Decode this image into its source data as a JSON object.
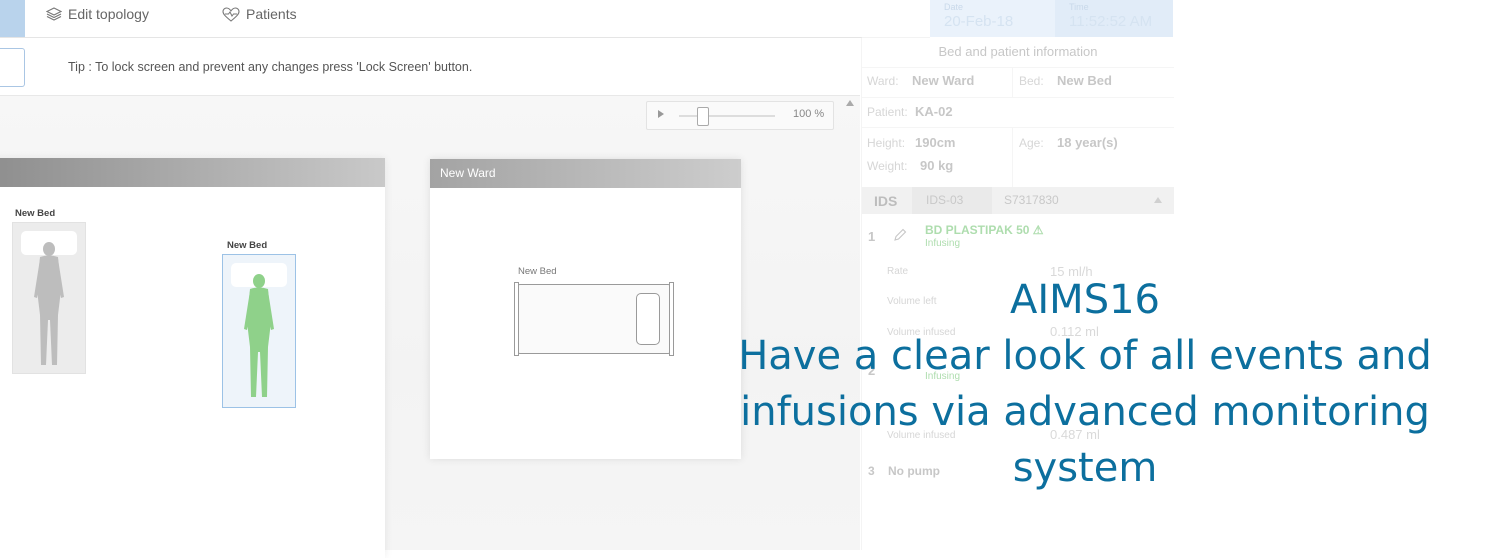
{
  "nav": {
    "edit_topology": "Edit topology",
    "patients": "Patients"
  },
  "datetime": {
    "date_label": "Date",
    "date_value": "20-Feb-18",
    "time_label": "Time",
    "time_value": "11:52:52 AM"
  },
  "tip": "Tip : To lock screen and prevent any changes press 'Lock Screen' button.",
  "zoom": {
    "value": "100 %",
    "level_percent": 100
  },
  "wards": [
    {
      "name": "",
      "beds": [
        {
          "label": "New Bed",
          "status": "empty"
        },
        {
          "label": "New Bed",
          "status": "occupied"
        }
      ]
    },
    {
      "name": "New Ward",
      "beds": [
        {
          "label": "New Bed"
        }
      ]
    }
  ],
  "panel": {
    "title": "Bed and patient information",
    "ward_label": "Ward:",
    "ward_value": "New Ward",
    "bed_label": "Bed:",
    "bed_value": "New Bed",
    "patient_label": "Patient:",
    "patient_value": "KA-02",
    "height_label": "Height:",
    "height_value": "190cm",
    "weight_label": "Weight:",
    "weight_value": "90 kg",
    "age_label": "Age:",
    "age_value": "18 year(s)",
    "ids": {
      "title": "IDS",
      "device": "IDS-03",
      "serial": "S7317830"
    },
    "pumps": [
      {
        "index": "1",
        "drug": "BD PLASTIPAK 50 ⚠",
        "status": "Infusing",
        "rows": [
          {
            "label": "Rate",
            "value": "15 ml/h"
          },
          {
            "label": "Volume left",
            "value": ""
          },
          {
            "label": "Volume infused",
            "value": "0.112 ml"
          }
        ]
      },
      {
        "index": "2",
        "status": "Infusing",
        "rows": [
          {
            "label": "Volume infused",
            "value": "0.487 ml"
          }
        ]
      },
      {
        "index": "3",
        "drug": "No pump"
      }
    ]
  },
  "caption": {
    "line1": "AIMS16",
    "line2": "Have a clear look of all events and",
    "line3": "infusions via advanced monitoring",
    "line4": "system"
  },
  "colors": {
    "caption": "#0c6f9e",
    "accent": "#b9d3ec",
    "occupied": "#8fd18a"
  }
}
